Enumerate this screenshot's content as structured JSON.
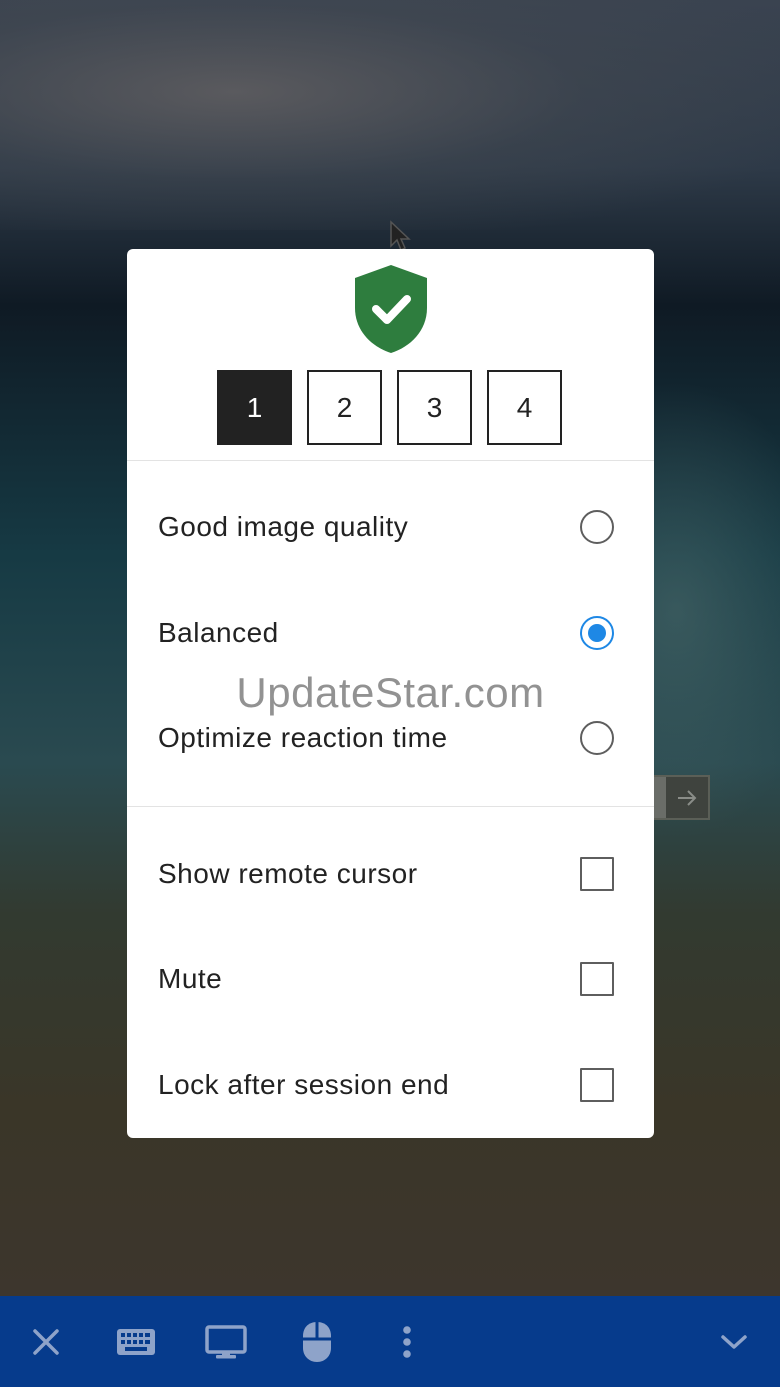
{
  "dialog": {
    "monitors": [
      {
        "label": "1",
        "active": true
      },
      {
        "label": "2",
        "active": false
      },
      {
        "label": "3",
        "active": false
      },
      {
        "label": "4",
        "active": false
      }
    ],
    "quality_options": [
      {
        "label": "Good image quality",
        "selected": false
      },
      {
        "label": "Balanced",
        "selected": true
      },
      {
        "label": "Optimize reaction time",
        "selected": false
      }
    ],
    "settings": [
      {
        "label": "Show remote cursor",
        "checked": false
      },
      {
        "label": "Mute",
        "checked": false
      },
      {
        "label": "Lock after session end",
        "checked": false
      }
    ],
    "watermark": "UpdateStar.com"
  },
  "icons": {
    "shield": "shield-check-icon",
    "close": "close-icon",
    "keyboard": "keyboard-icon",
    "monitor": "monitor-icon",
    "mouse": "mouse-icon",
    "more": "more-vertical-icon",
    "collapse": "chevron-down-icon",
    "side_arrow": "arrow-right-icon"
  },
  "colors": {
    "accent": "#1e88e5",
    "shield": "#2e7d3e",
    "toolbar": "#063b8c",
    "toolbar_icon": "#8ea3c9"
  }
}
